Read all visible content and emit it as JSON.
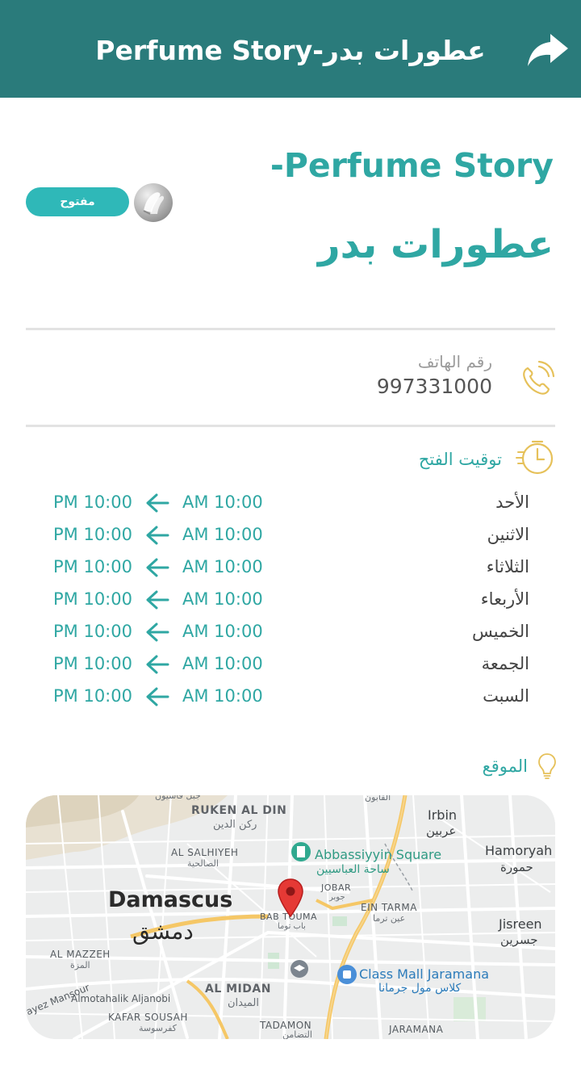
{
  "app_bar": {
    "title": "Perfume Story-عطورات بدر",
    "share_icon": "share-arrow-icon"
  },
  "store": {
    "name_line1": "-Perfume Story",
    "name_line2": "عطورات بدر",
    "status": "مفتوح",
    "status_color": "#2fb8b8",
    "logo_icon": "store-logo"
  },
  "contact": {
    "phone_label": "رقم الهاتف",
    "phone_number": "997331000",
    "icon": "phone-icon"
  },
  "hours": {
    "title": "توقيت الفتح",
    "icon": "clock-icon",
    "rows": [
      {
        "day": "الأحد",
        "open": "AM 10:00",
        "close": "PM 10:00"
      },
      {
        "day": "الاثنين",
        "open": "AM 10:00",
        "close": "PM 10:00"
      },
      {
        "day": "الثلاثاء",
        "open": "AM 10:00",
        "close": "PM 10:00"
      },
      {
        "day": "الأربعاء",
        "open": "AM 10:00",
        "close": "PM 10:00"
      },
      {
        "day": "الخميس",
        "open": "AM 10:00",
        "close": "PM 10:00"
      },
      {
        "day": "الجمعة",
        "open": "AM 10:00",
        "close": "PM 10:00"
      },
      {
        "day": "السبت",
        "open": "AM 10:00",
        "close": "PM 10:00"
      }
    ]
  },
  "location": {
    "title": "الموقع",
    "icon": "lightbulb-icon",
    "map": {
      "labels": {
        "ruken_en": "RUKEN AL DIN",
        "ruken_ar": "ركن الدين",
        "salhiyeh_en": "AL SALHIYEH",
        "salhiyeh_ar": "الصالحية",
        "damascus_en": "Damascus",
        "damascus_ar": "دمشق",
        "mazzeh_en": "AL MAZZEH",
        "mazzeh_ar": "المزة",
        "fayez": "ayez Mansour",
        "motahalik": "Almotahalik Aljanobi",
        "kafar_en": "KAFAR SOUSAH",
        "kafar_ar": "كفرسوسة",
        "midan_en": "AL MIDAN",
        "midan_ar": "الميدان",
        "tadamon_en": "TADAMON",
        "tadamon_ar": "التضامن",
        "bab_touma_en": "BAB TOUMA",
        "bab_touma_ar": "باب توما",
        "jobar_en": "JOBAR",
        "jobar_ar": "جوبر",
        "ein_tarma_en": "EIN TARMA",
        "ein_tarma_ar": "عين ترما",
        "irbin_en": "Irbin",
        "irbin_ar": "عربين",
        "hamoryah_en": "Hamoryah",
        "hamoryah_ar": "حمورة",
        "jisreen_en": "Jisreen",
        "jisreen_ar": "جسرين",
        "jaramana": "JARAMANA",
        "abbassiyyin_en": "Abbassiyyin Square",
        "abbassiyyin_ar": "ساحة العباسيين",
        "classmall_en": "Class Mall Jaramana",
        "classmall_ar": "كلاس مول جرمانا",
        "qasioun_ar": "جبل قاسيون",
        "top_label": "القابون"
      },
      "pin_icon": "map-pin-icon"
    }
  }
}
